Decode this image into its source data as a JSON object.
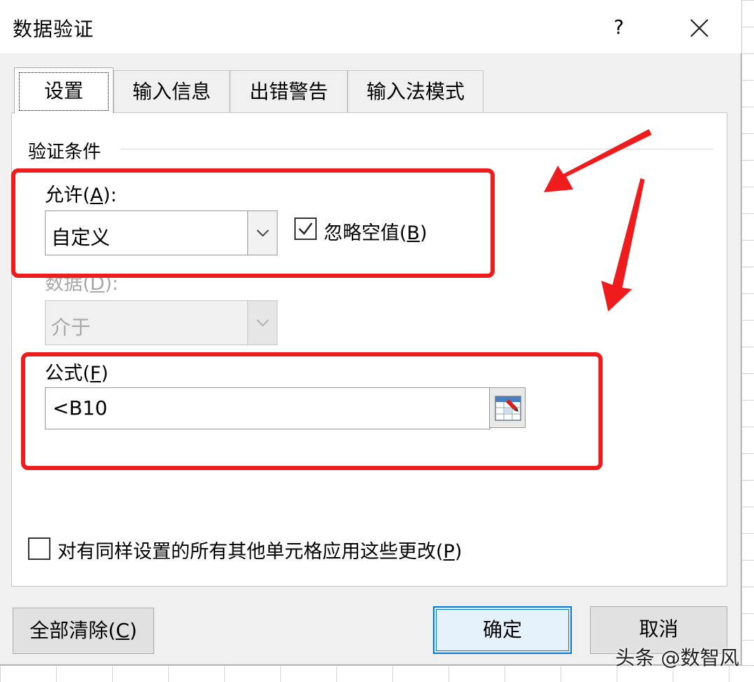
{
  "dialog": {
    "title": "数据验证",
    "help_label": "?",
    "close_icon": "close-icon"
  },
  "tabs": [
    {
      "label": "设置",
      "active": true
    },
    {
      "label": "输入信息",
      "active": false
    },
    {
      "label": "出错警告",
      "active": false
    },
    {
      "label": "输入法模式",
      "active": false
    }
  ],
  "validation": {
    "section_title": "验证条件",
    "allow_label_prefix": "允许(",
    "allow_label_key": "A",
    "allow_label_suffix": "):",
    "allow_value": "自定义",
    "ignore_blank_prefix": "忽略空值(",
    "ignore_blank_key": "B",
    "ignore_blank_suffix": ")",
    "ignore_blank_checked": true,
    "data_label_prefix": "数据(",
    "data_label_key": "D",
    "data_label_suffix": "):",
    "data_value": "介于",
    "formula_label_prefix": "公式(",
    "formula_label_key": "F",
    "formula_label_suffix": ")",
    "formula_value": "<B10"
  },
  "apply_all": {
    "label_prefix": "对有同样设置的所有其他单元格应用这些更改(",
    "label_key": "P",
    "label_suffix": ")",
    "checked": false
  },
  "buttons": {
    "clear_all_prefix": "全部清除(",
    "clear_all_key": "C",
    "clear_all_suffix": ")",
    "ok": "确定",
    "cancel": "取消"
  },
  "watermark": "头条 @数智风",
  "colors": {
    "annotation_red": "#ee1c1c",
    "focus_blue": "#0078d7",
    "dialog_bg": "#f0f0f0"
  }
}
